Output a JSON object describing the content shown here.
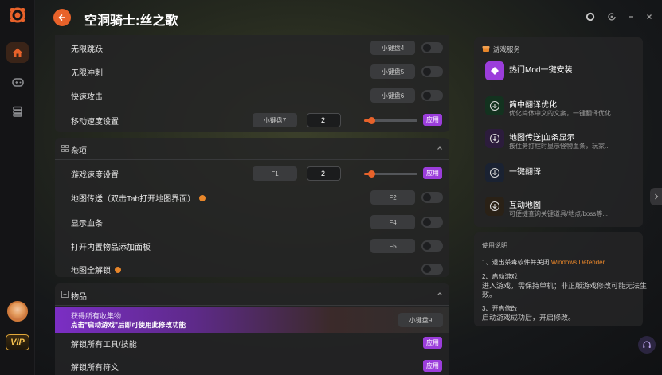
{
  "app": {
    "title": "空洞骑士:丝之歌",
    "vip_label": "VIP",
    "colors": {
      "accent": "#e8622a",
      "apply": "#9b3ddb",
      "orange_text": "#e8862a"
    }
  },
  "sidebar": {
    "icons": [
      "logo-icon",
      "home-icon",
      "gamepad-icon",
      "stack-icon"
    ]
  },
  "window_controls": [
    "settings-icon",
    "refresh-icon",
    "minimize-icon",
    "close-icon"
  ],
  "cheats_top": [
    {
      "label": "无限跳跃",
      "key": "小键盘4"
    },
    {
      "label": "无限冲刺",
      "key": "小键盘5"
    },
    {
      "label": "快速攻击",
      "key": "小键盘6"
    }
  ],
  "move_speed": {
    "label": "移动速度设置",
    "key": "小键盘7",
    "value": "2",
    "apply": "应用",
    "level": 0.14
  },
  "misc_section": {
    "title": "杂项",
    "game_speed": {
      "label": "游戏速度设置",
      "key": "F1",
      "value": "2",
      "apply": "应用",
      "level": 0.14
    },
    "items": [
      {
        "label": "地图传送（双击Tab打开地图界面）",
        "key": "F2",
        "info": true
      },
      {
        "label": "显示血条",
        "key": "F4",
        "info": false
      },
      {
        "label": "打开内置物品添加面板",
        "key": "F5",
        "info": false
      },
      {
        "label": "地图全解锁",
        "key": "",
        "info": true
      }
    ]
  },
  "items_section": {
    "title": "物品",
    "promo": {
      "line1": "获得所有收集物",
      "line2": "点击\"启动游戏\"后即可使用此修改功能",
      "key": "小键盘9"
    },
    "rows": [
      {
        "label": "解锁所有工具/技能",
        "apply": "应用"
      },
      {
        "label": "解锁所有符文",
        "apply": "应用"
      }
    ]
  },
  "services": {
    "title": "游戏服务",
    "items": [
      {
        "title": "热门Mod一键安装",
        "sub": "",
        "icon": "mod-icon"
      },
      {
        "title": "简中翻译优化",
        "sub": "优化简体中文的文案，一键翻译优化",
        "icon": "download-icon"
      },
      {
        "title": "地图传送|血条显示",
        "sub": "按住务打程时显示怪物血条，玩家...",
        "icon": "download-icon"
      },
      {
        "title": "一键翻译",
        "sub": "",
        "icon": "download-icon"
      },
      {
        "title": "互动地图",
        "sub": "可便捷查询关键道具/地点/boss等...",
        "icon": "download-icon"
      }
    ]
  },
  "guide": {
    "title": "使用说明",
    "step1_prefix": "1、退出杀毒软件并关闭",
    "step1_highlight": "Windows Defender",
    "step2_title": "2、启动游戏",
    "step2_body1": "进入游戏，需保持单机；非正版游戏修改可能无法生",
    "step2_body2": "效。",
    "step3_title": "3、开启修改",
    "step3_body": "启动游戏成功后，开启修改。"
  }
}
